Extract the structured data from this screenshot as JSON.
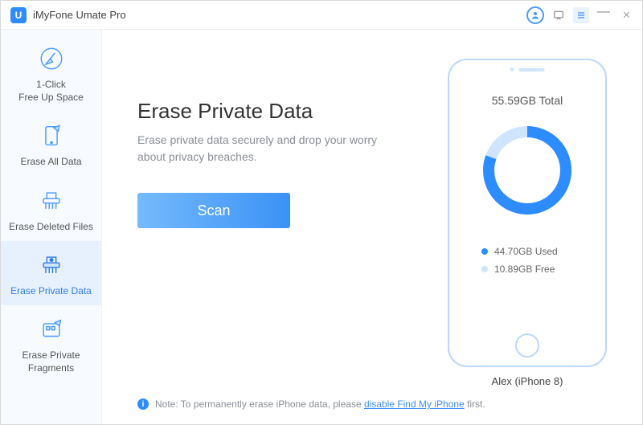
{
  "app": {
    "logo_letter": "U",
    "title": "iMyFone Umate Pro"
  },
  "sidebar": {
    "items": [
      {
        "label": "1-Click\nFree Up Space"
      },
      {
        "label": "Erase All Data"
      },
      {
        "label": "Erase Deleted Files"
      },
      {
        "label": "Erase Private Data"
      },
      {
        "label": "Erase Private\nFragments"
      }
    ]
  },
  "main": {
    "heading": "Erase Private Data",
    "subheading": "Erase private data securely and drop your worry about privacy breaches.",
    "scan_label": "Scan"
  },
  "device": {
    "total_label": "55.59GB Total",
    "used_label": "44.70GB Used",
    "free_label": "10.89GB Free",
    "name": "Alex (iPhone 8)",
    "used_fraction": 0.804,
    "colors": {
      "used": "#2d8cff",
      "free": "#cfe4fd"
    }
  },
  "note": {
    "prefix": "Note: To permanently erase iPhone data, please ",
    "link_text": "disable Find My iPhone",
    "suffix": " first."
  }
}
